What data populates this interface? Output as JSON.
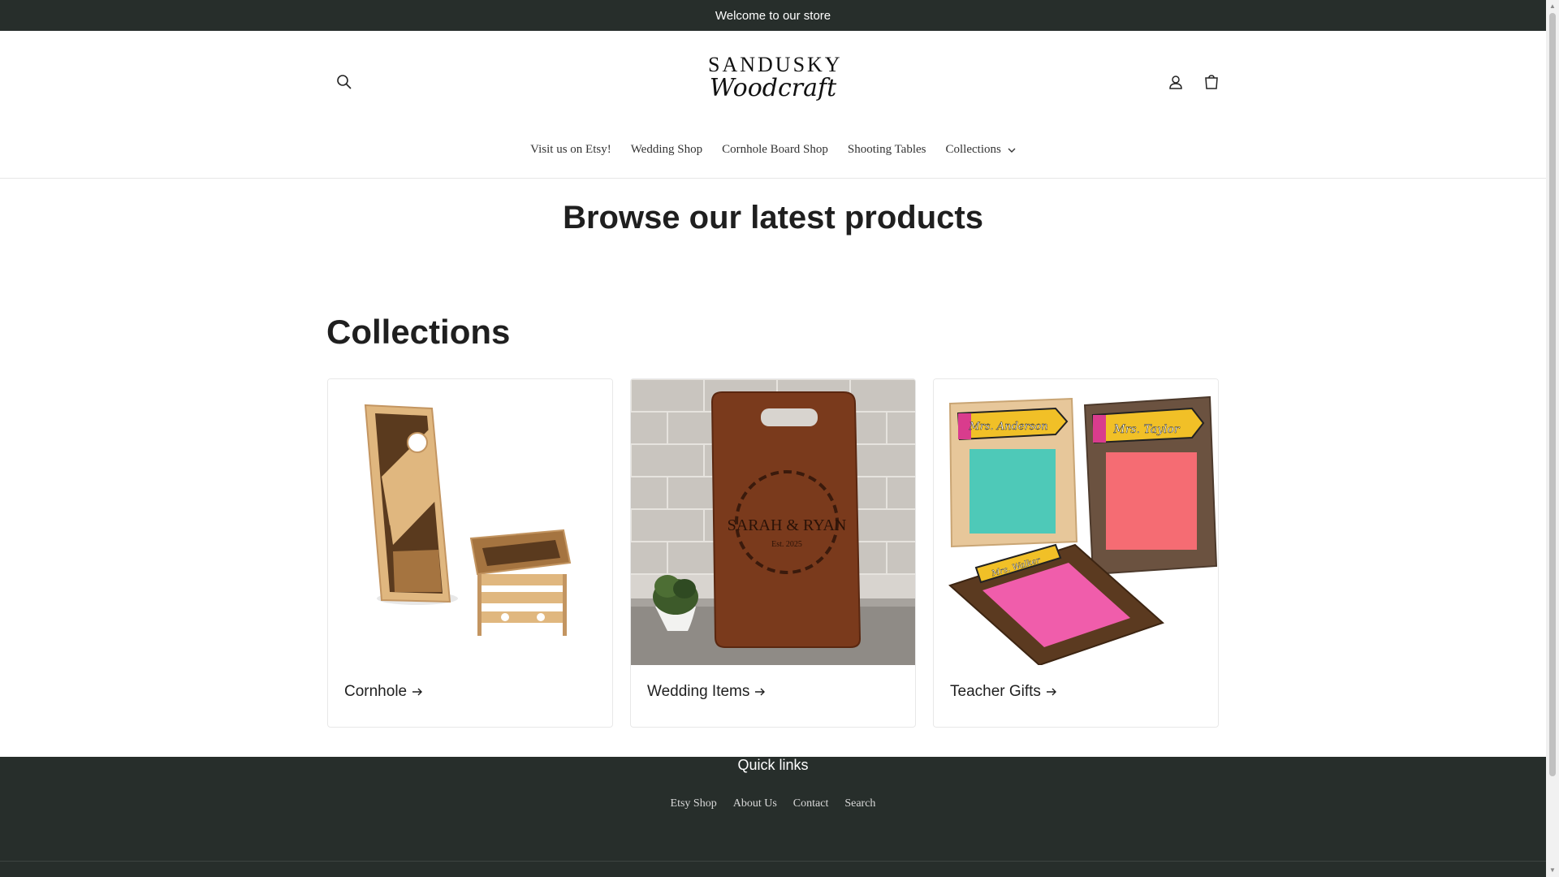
{
  "announcement": {
    "text": "Welcome to our store"
  },
  "header": {
    "logo_top": "SANDUSKY",
    "logo_script": "Woodcraft",
    "icons": {
      "search": "search-icon",
      "account": "account-icon",
      "cart": "cart-icon"
    }
  },
  "nav": {
    "items": [
      {
        "label": "Visit us on Etsy!"
      },
      {
        "label": "Wedding Shop"
      },
      {
        "label": "Cornhole Board Shop"
      },
      {
        "label": "Shooting Tables"
      },
      {
        "label": "Collections"
      }
    ]
  },
  "main": {
    "title": "Browse our latest products",
    "collections_title": "Collections",
    "collections": [
      {
        "label": "Cornhole"
      },
      {
        "label": "Wedding Items",
        "board_text": "SARAH & RYAN",
        "board_sub": "Est. 2025"
      },
      {
        "label": "Teacher Gifts",
        "names": [
          "Mrs. Anderson",
          "Mrs. Taylor",
          "Mrs. Walker"
        ]
      }
    ]
  },
  "footer": {
    "title": "Quick links",
    "links": [
      {
        "label": "Etsy Shop"
      },
      {
        "label": "About Us"
      },
      {
        "label": "Contact"
      },
      {
        "label": "Search"
      }
    ]
  },
  "colors": {
    "dark": "#272e2b",
    "text": "#1f1f1f"
  }
}
